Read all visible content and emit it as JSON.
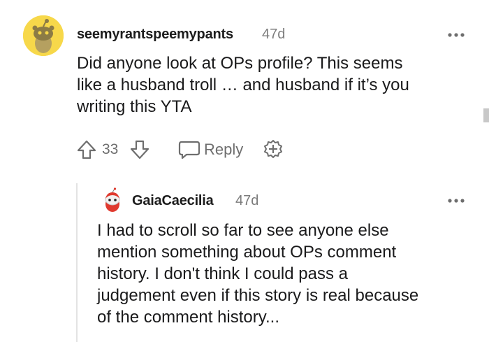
{
  "comments": [
    {
      "username": "seemyrantspeemypants",
      "age": "47d",
      "body_lines": [
        "Did anyone look at OPs profile? This seems",
        "like a husband troll … and husband if it’s you",
        "writing this YTA"
      ],
      "score": "33",
      "reply_label": "Reply"
    },
    {
      "username": "GaiaCaecilia",
      "age": "47d",
      "body_lines": [
        "I had to scroll so far to see anyone else",
        "mention something about OPs comment",
        "history. I don't think I could pass a",
        "judgement even if this story is real because",
        "of the comment history..."
      ]
    }
  ],
  "icons": {
    "avatar_1": "snoo-avatar-icon",
    "avatar_2": "red-hair-avatar-icon",
    "more": "more-options-icon",
    "upvote": "upvote-arrow-icon",
    "downvote": "downvote-arrow-icon",
    "reply": "speech-bubble-icon",
    "award": "award-plus-icon"
  },
  "colors": {
    "avatar_1_bg": "#f7d84a",
    "meta_gray": "#7c7c7c",
    "text": "#1a1a1b",
    "thread_line": "#e3e3e3"
  }
}
